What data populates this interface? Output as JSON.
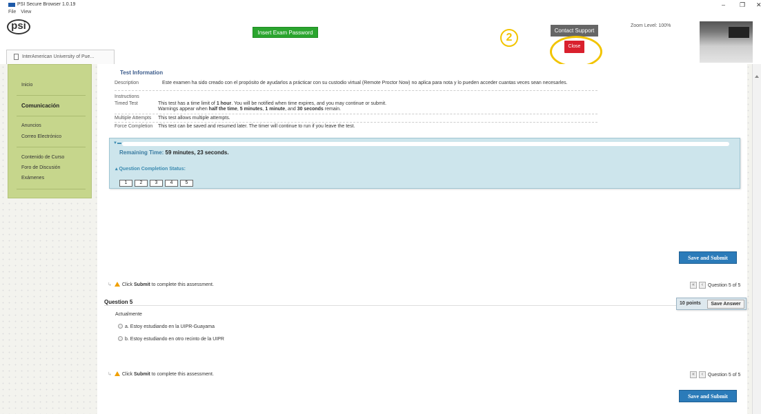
{
  "window": {
    "title": "PSI Secure Browser 1.0.19",
    "minimize": "–",
    "maximize": "❐",
    "close": "✕",
    "menu": [
      "File",
      "View"
    ]
  },
  "psi_bar": {
    "logo_text": "psi",
    "tab_label": "InterAmerican University of Pue...",
    "insert_password_button": "Insert Exam Password",
    "step_badge": "2",
    "contact_support_button": "Contact Support",
    "close_button": "Close",
    "zoom_level": "Zoom Level: 100%",
    "highlight_color": "#f2c400"
  },
  "sidebar": {
    "items": [
      {
        "label": "Inicio"
      },
      {
        "label": "Comunicación"
      },
      {
        "label": "Anuncios"
      },
      {
        "label": "Correo Electrónico"
      },
      {
        "label": "Contenido de Curso"
      },
      {
        "label": "Foro de Discusión"
      },
      {
        "label": "Exámenes"
      }
    ]
  },
  "test_info": {
    "heading": "Test Information",
    "description_label": "Description",
    "description": "Este examen ha sido creado con el propósito de ayudarlos a prácticar con su custodio virtual (Remote Proctor Now) no aplica para nota y lo pueden acceder cuantas veces sean necesarles.",
    "instructions_label": "Instructions",
    "timed_label": "Timed Test",
    "timed_line1_a": "This test has a time limit of ",
    "timed_line1_b": "1 hour",
    "timed_line1_c": ". You will be notified when time expires, and you may continue or submit.",
    "timed_line2_a": "Warnings appear when ",
    "timed_line2_b": "half the time",
    "timed_line2_c": ", ",
    "timed_line2_d": "5 minutes",
    "timed_line2_e": ", ",
    "timed_line2_f": "1 minute",
    "timed_line2_g": ", and ",
    "timed_line2_h": "30 seconds",
    "timed_line2_i": " remain.",
    "attempts_label": "Multiple Attempts",
    "attempts": "This test allows multiple attempts.",
    "force_label": "Force Completion",
    "force": "This test can be saved and resumed later. The timer will continue to run if you leave the test."
  },
  "timer": {
    "remaining_label": "Remaining Time: ",
    "remaining_value": "59 minutes, 23 seconds.",
    "completion_status": "Question Completion Status:",
    "question_numbers": [
      "1",
      "2",
      "3",
      "4",
      "5"
    ]
  },
  "actions": {
    "save_and_submit": "Save and Submit",
    "click_label": "Click ",
    "submit_word": "Submit",
    "complete_text": " to complete this assessment.",
    "pager_label": "Question 5 of 5",
    "first_symbol": "«",
    "prev_symbol": "‹"
  },
  "question": {
    "title": "Question 5",
    "points": "10 points",
    "save_answer": "Save Answer",
    "text": "Actualmente",
    "options": [
      {
        "label": "a. Estoy estudiando en la UIPR-Guayama"
      },
      {
        "label": "b. Estoy estudiando en otro recinto de la UIPR"
      }
    ]
  }
}
